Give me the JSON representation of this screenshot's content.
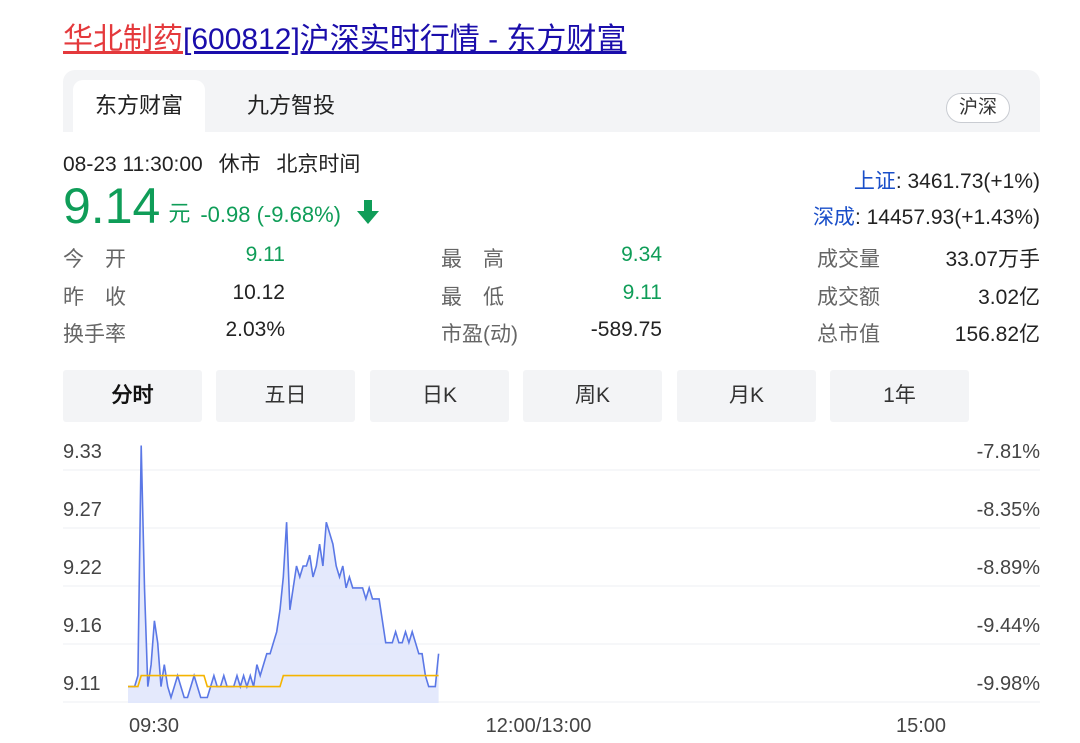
{
  "title": {
    "name": "华北制药",
    "rest": "[600812]沪深实时行情 - 东方财富"
  },
  "tabs": {
    "items": [
      "东方财富",
      "九方智投"
    ],
    "market": "沪深"
  },
  "status": {
    "datetime": "08-23 11:30:00",
    "state": "休市",
    "zone": "北京时间"
  },
  "quote": {
    "price": "9.14",
    "unit": "元",
    "change": "-0.98 (-9.68%)",
    "direction": "down"
  },
  "indices": [
    {
      "name": "上证",
      "value": ": 3461.73(+1%)"
    },
    {
      "name": "深成",
      "value": ": 14457.93(+1.43%)"
    }
  ],
  "stats": {
    "open": {
      "label": "今　开",
      "value": "9.11"
    },
    "prev_close": {
      "label": "昨　收",
      "value": "10.12"
    },
    "turnover_rate": {
      "label": "换手率",
      "value": "2.03%"
    },
    "high": {
      "label": "最　高",
      "value": "9.34"
    },
    "low": {
      "label": "最　低",
      "value": "9.11"
    },
    "pe": {
      "label": "市盈(动)",
      "value": "-589.75"
    },
    "volume": {
      "label": "成交量",
      "value": "33.07万手"
    },
    "amount": {
      "label": "成交额",
      "value": "3.02亿"
    },
    "market_cap": {
      "label": "总市值",
      "value": "156.82亿"
    }
  },
  "ranges": {
    "items": [
      "分时",
      "五日",
      "日K",
      "周K",
      "月K",
      "1年"
    ],
    "active": 0
  },
  "colors": {
    "price_line": "#5b78e6",
    "avg_line": "#f5b400",
    "fill": "#dfe5fb",
    "down": "#0f9d58",
    "up": "#e4393c"
  },
  "chart_data": {
    "type": "line",
    "x_ticks": [
      "09:30",
      "12:00/13:00",
      "15:00"
    ],
    "y_ticks_left": [
      "9.33",
      "9.27",
      "9.22",
      "9.16",
      "9.11"
    ],
    "y_ticks_right": [
      "-7.81%",
      "-8.35%",
      "-8.89%",
      "-9.44%",
      "-9.98%"
    ],
    "ylim": [
      9.095,
      9.335
    ],
    "x_range": [
      0,
      240
    ],
    "series": [
      {
        "values": [
          9.11,
          9.11,
          9.11,
          9.12,
          9.33,
          9.2,
          9.11,
          9.13,
          9.17,
          9.15,
          9.11,
          9.13,
          9.11,
          9.1,
          9.11,
          9.12,
          9.11,
          9.1,
          9.1,
          9.11,
          9.12,
          9.11,
          9.1,
          9.1,
          9.1,
          9.11,
          9.12,
          9.11,
          9.11,
          9.12,
          9.11,
          9.11,
          9.11,
          9.12,
          9.11,
          9.12,
          9.11,
          9.12,
          9.11,
          9.13,
          9.12,
          9.13,
          9.14,
          9.14,
          9.15,
          9.16,
          9.18,
          9.21,
          9.26,
          9.18,
          9.2,
          9.22,
          9.21,
          9.22,
          9.22,
          9.23,
          9.21,
          9.22,
          9.24,
          9.22,
          9.26,
          9.25,
          9.24,
          9.22,
          9.21,
          9.22,
          9.2,
          9.21,
          9.2,
          9.2,
          9.2,
          9.2,
          9.19,
          9.2,
          9.19,
          9.19,
          9.19,
          9.17,
          9.15,
          9.15,
          9.15,
          9.16,
          9.15,
          9.15,
          9.16,
          9.15,
          9.16,
          9.15,
          9.14,
          9.14,
          9.12,
          9.11,
          9.11,
          9.11,
          9.14
        ]
      },
      {
        "values": [
          9.11,
          9.11,
          9.11,
          9.11,
          9.12,
          9.12,
          9.12,
          9.12,
          9.12,
          9.12,
          9.12,
          9.12,
          9.12,
          9.12,
          9.12,
          9.12,
          9.12,
          9.12,
          9.12,
          9.12,
          9.12,
          9.12,
          9.12,
          9.12,
          9.11,
          9.11,
          9.11,
          9.11,
          9.11,
          9.11,
          9.11,
          9.11,
          9.11,
          9.11,
          9.11,
          9.11,
          9.11,
          9.11,
          9.11,
          9.11,
          9.11,
          9.11,
          9.11,
          9.11,
          9.11,
          9.11,
          9.11,
          9.12,
          9.12,
          9.12,
          9.12,
          9.12,
          9.12,
          9.12,
          9.12,
          9.12,
          9.12,
          9.12,
          9.12,
          9.12,
          9.12,
          9.12,
          9.12,
          9.12,
          9.12,
          9.12,
          9.12,
          9.12,
          9.12,
          9.12,
          9.12,
          9.12,
          9.12,
          9.12,
          9.12,
          9.12,
          9.12,
          9.12,
          9.12,
          9.12,
          9.12,
          9.12,
          9.12,
          9.12,
          9.12,
          9.12,
          9.12,
          9.12,
          9.12,
          9.12,
          9.12,
          9.12,
          9.12,
          9.12,
          9.12
        ]
      }
    ]
  }
}
